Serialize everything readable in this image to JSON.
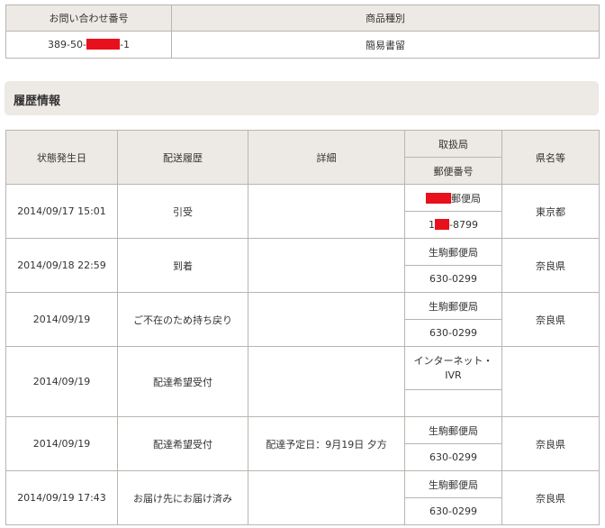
{
  "inquiry": {
    "headers": [
      "お問い合わせ番号",
      "商品種別"
    ],
    "number_prefix": "389-50-",
    "number_suffix": "-1",
    "product_type": "簡易書留"
  },
  "section": {
    "title": "履歴情報"
  },
  "history": {
    "headers": {
      "date": "状態発生日",
      "status": "配送履歴",
      "detail": "詳細",
      "office": "取扱局",
      "postal": "郵便番号",
      "prefecture": "県名等"
    },
    "rows": [
      {
        "date": "2014/09/17 15:01",
        "status": "引受",
        "detail": "",
        "office": "郵便局",
        "office_redacted": true,
        "postal_prefix": "1",
        "postal": "-8799",
        "postal_redacted": true,
        "prefecture": "東京都"
      },
      {
        "date": "2014/09/18 22:59",
        "status": "到着",
        "detail": "",
        "office": "生駒郵便局",
        "postal": "630-0299",
        "prefecture": "奈良県"
      },
      {
        "date": "2014/09/19",
        "status": "ご不在のため持ち戻り",
        "detail": "",
        "office": "生駒郵便局",
        "postal": "630-0299",
        "prefecture": "奈良県"
      },
      {
        "date": "2014/09/19",
        "status": "配達希望受付",
        "detail": "",
        "office": "インターネット・IVR",
        "postal": "",
        "prefecture": ""
      },
      {
        "date": "2014/09/19",
        "status": "配達希望受付",
        "detail": "配達予定日：9月19日 夕方",
        "office": "生駒郵便局",
        "postal": "630-0299",
        "prefecture": "奈良県"
      },
      {
        "date": "2014/09/19 17:43",
        "status": "お届け先にお届け済み",
        "detail": "",
        "office": "生駒郵便局",
        "postal": "630-0299",
        "prefecture": "奈良県"
      }
    ]
  },
  "colors": {
    "header_bg": "#ede9e4",
    "border": "#b9b5b0",
    "redaction": "#e8101c"
  }
}
